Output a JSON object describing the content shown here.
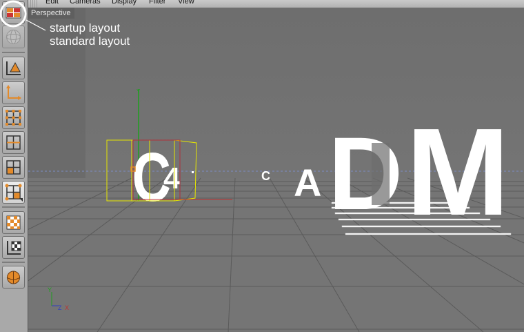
{
  "menubar": {
    "items": [
      "Edit",
      "Cameras",
      "Display",
      "Filter",
      "View"
    ]
  },
  "viewport": {
    "title": "Perspective",
    "axis_labels": {
      "y": "Y",
      "z": "Z",
      "x": "X"
    },
    "scene_text": {
      "big_c": "C",
      "four": "4",
      "small_c": "C",
      "a": "A",
      "d": "D",
      "m": "M"
    }
  },
  "callouts": {
    "line1": "startup layout",
    "line2": "standard layout"
  },
  "toolbar": {
    "buttons": [
      "layout-icon",
      "scene-sphere-icon",
      "model-mode-icon",
      "object-axis-icon",
      "points-icon",
      "edges-icon",
      "polygons-icon",
      "uvw-icon",
      "texture-icon",
      "texture-axis-icon",
      "paint-icon"
    ]
  },
  "colors": {
    "viewport_bg": "#6d6d6d",
    "toolbar_bg": "#a9a9a9",
    "accent_orange": "#e38a2a",
    "selection_yellow": "#e6e600"
  }
}
